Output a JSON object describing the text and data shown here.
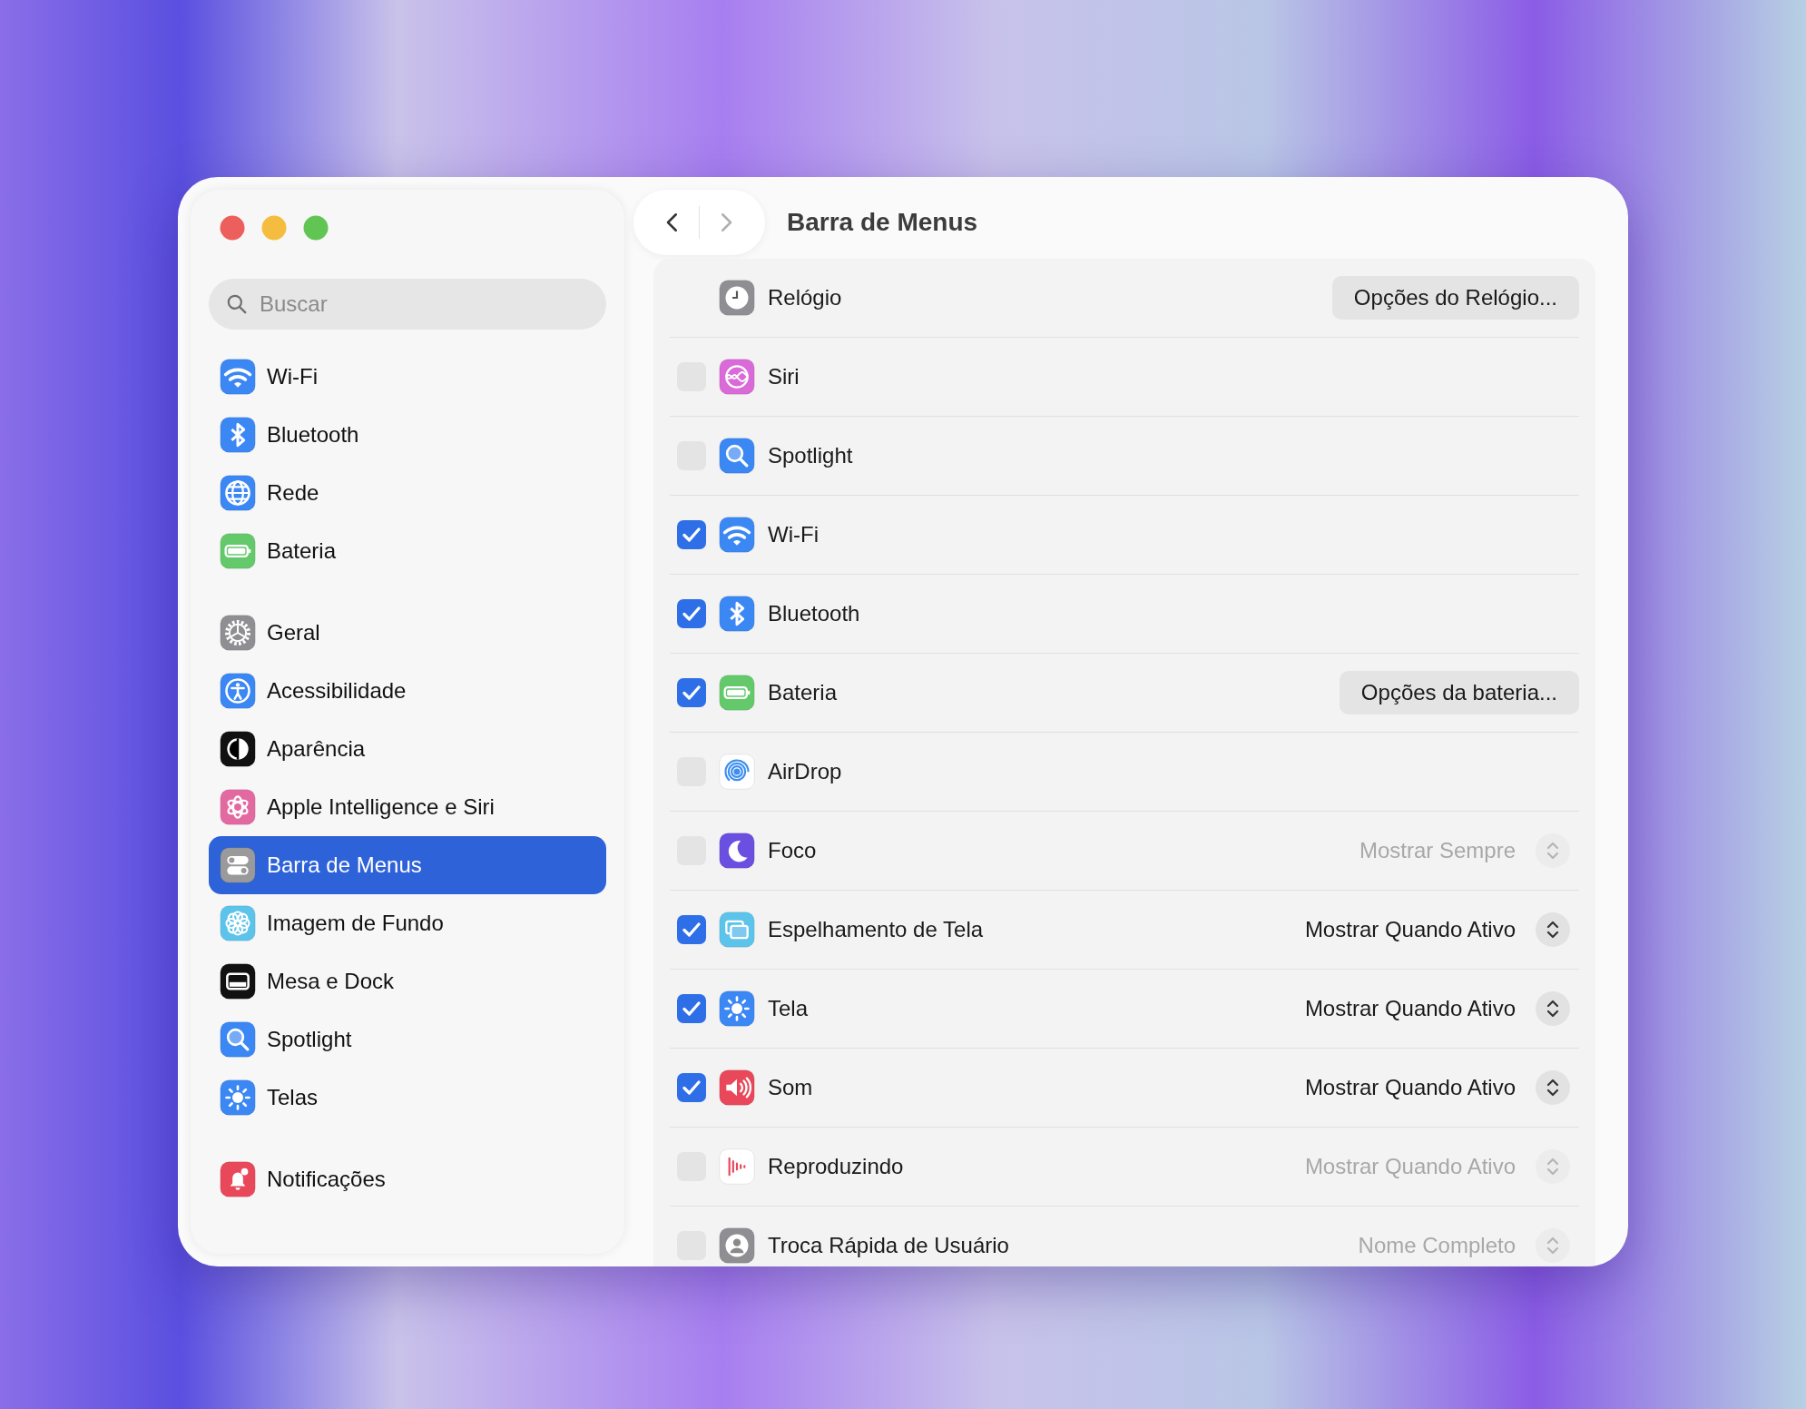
{
  "window": {
    "title": "Barra de Menus"
  },
  "navigation": {
    "back": {
      "disabled": false
    },
    "forward": {
      "disabled": true
    }
  },
  "search": {
    "placeholder": "Buscar"
  },
  "sidebar": {
    "groups": [
      {
        "items": [
          {
            "label": "Wi-Fi",
            "selected": false
          },
          {
            "label": "Bluetooth",
            "selected": false
          },
          {
            "label": "Rede",
            "selected": false
          },
          {
            "label": "Bateria",
            "selected": false
          }
        ]
      },
      {
        "items": [
          {
            "label": "Geral",
            "selected": false
          },
          {
            "label": "Acessibilidade",
            "selected": false
          },
          {
            "label": "Aparência",
            "selected": false
          },
          {
            "label": "Apple Intelligence e Siri",
            "selected": false
          },
          {
            "label": "Barra de Menus",
            "selected": true
          },
          {
            "label": "Imagem de Fundo",
            "selected": false
          },
          {
            "label": "Mesa e Dock",
            "selected": false
          },
          {
            "label": "Spotlight",
            "selected": false
          },
          {
            "label": "Telas",
            "selected": false
          }
        ]
      },
      {
        "items": [
          {
            "label": "Notificações",
            "selected": false
          }
        ]
      }
    ]
  },
  "rows": [
    {
      "kind": "plain",
      "label": "Relógio",
      "button": "Opções do Relógio..."
    },
    {
      "kind": "checkbox",
      "label": "Siri",
      "checked": false
    },
    {
      "kind": "checkbox",
      "label": "Spotlight",
      "checked": false
    },
    {
      "kind": "checkbox",
      "label": "Wi-Fi",
      "checked": true
    },
    {
      "kind": "checkbox",
      "label": "Bluetooth",
      "checked": true
    },
    {
      "kind": "checkbox",
      "label": "Bateria",
      "checked": true,
      "button": "Opções da bateria..."
    },
    {
      "kind": "checkbox",
      "label": "AirDrop",
      "checked": false
    },
    {
      "kind": "checkbox",
      "label": "Foco",
      "checked": false,
      "popup": {
        "value": "Mostrar Sempre",
        "disabled": true
      }
    },
    {
      "kind": "checkbox",
      "label": "Espelhamento de Tela",
      "checked": true,
      "popup": {
        "value": "Mostrar Quando Ativo",
        "disabled": false
      }
    },
    {
      "kind": "checkbox",
      "label": "Tela",
      "checked": true,
      "popup": {
        "value": "Mostrar Quando Ativo",
        "disabled": false
      }
    },
    {
      "kind": "checkbox",
      "label": "Som",
      "checked": true,
      "popup": {
        "value": "Mostrar Quando Ativo",
        "disabled": false
      }
    },
    {
      "kind": "checkbox",
      "label": "Reproduzindo",
      "checked": false,
      "popup": {
        "value": "Mostrar Quando Ativo",
        "disabled": true
      }
    },
    {
      "kind": "checkbox",
      "label": "Troca Rápida de Usuário",
      "checked": false,
      "popup": {
        "value": "Nome Completo",
        "disabled": true
      }
    }
  ]
}
